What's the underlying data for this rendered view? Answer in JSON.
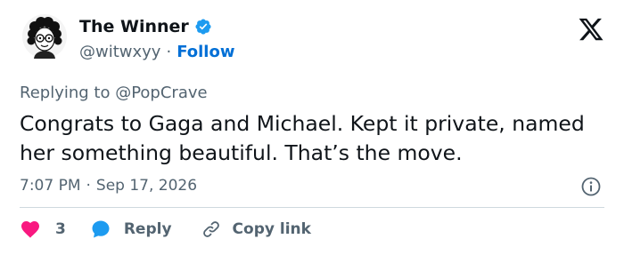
{
  "author": {
    "display_name": "The Winner",
    "handle": "@witwxyy",
    "follow_label": "Follow",
    "separator": "·"
  },
  "reply_context": {
    "prefix": "Replying to ",
    "mention": "@PopCrave"
  },
  "tweet": {
    "text": "Congrats to Gaga and Michael. Kept it private, named her something beautiful. That’s the move."
  },
  "meta": {
    "time": "7:07 PM",
    "separator": "·",
    "date": "Sep 17, 2026"
  },
  "actions": {
    "like_count": "3",
    "reply_label": "Reply",
    "copy_link_label": "Copy link"
  },
  "icons": {
    "verified": "verified-badge-icon",
    "x_logo": "x-logo-icon",
    "info": "info-icon",
    "heart": "heart-icon",
    "reply": "reply-bubble-icon",
    "link": "link-icon"
  },
  "colors": {
    "accent": "#1d9bf0",
    "follow": "#006fd6",
    "heart": "#f91880",
    "text": "#0f1419",
    "secondary": "#536471"
  }
}
